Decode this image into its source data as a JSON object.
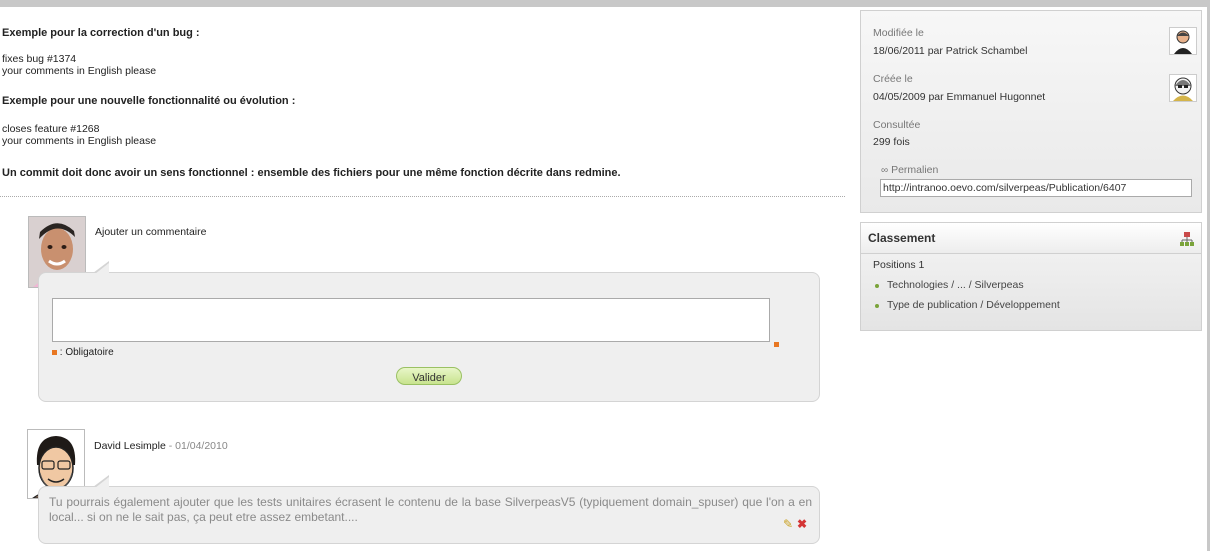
{
  "document": {
    "bug_heading": "Exemple pour la correction d'un bug :",
    "bug_line1": "fixes bug #1374",
    "bug_line2": "your comments in English please",
    "feature_heading": "Exemple pour une nouvelle fonctionnalité ou évolution :",
    "feature_line1": "closes feature #1268",
    "feature_line2": "your comments in English please",
    "commit_note": "Un commit doit donc avoir un sens fonctionnel : ensemble des fichiers pour une même fonction décrite dans redmine."
  },
  "composer": {
    "label": "Ajouter un commentaire",
    "input_value": "",
    "required_text": ": Obligatoire",
    "submit_label": "Valider"
  },
  "comments": [
    {
      "author": "David Lesimple",
      "separator": " - ",
      "date": "01/04/2010",
      "text": "Tu pourrais également ajouter que les tests unitaires écrasent le contenu de la base SilverpeasV5 (typiquement domain_spuser) que l'on a en local... si on ne le sait pas, ça peut etre assez embetant...."
    }
  ],
  "info": {
    "modified_label": "Modifiée le",
    "modified_value": "18/06/2011 par Patrick Schambel",
    "created_label": "Créée le",
    "created_value": "04/05/2009 par Emmanuel Hugonnet",
    "views_label": "Consultée",
    "views_value": "299 fois",
    "permalink_label": "Permalien",
    "permalink_value": "http://intranoo.oevo.com/silverpeas/Publication/6407"
  },
  "classification": {
    "title": "Classement",
    "positions_label": "Positions 1",
    "items": [
      "Technologies / ... / Silverpeas",
      "Type de publication / Développement"
    ]
  },
  "colors": {
    "required_accent": "#e87722",
    "button_green": "#c8e38e",
    "bullet_green": "#7aa33a"
  },
  "icons": {
    "permalink": "link-icon",
    "classification": "tree-icon",
    "edit": "pencil-icon",
    "delete": "delete-icon"
  }
}
